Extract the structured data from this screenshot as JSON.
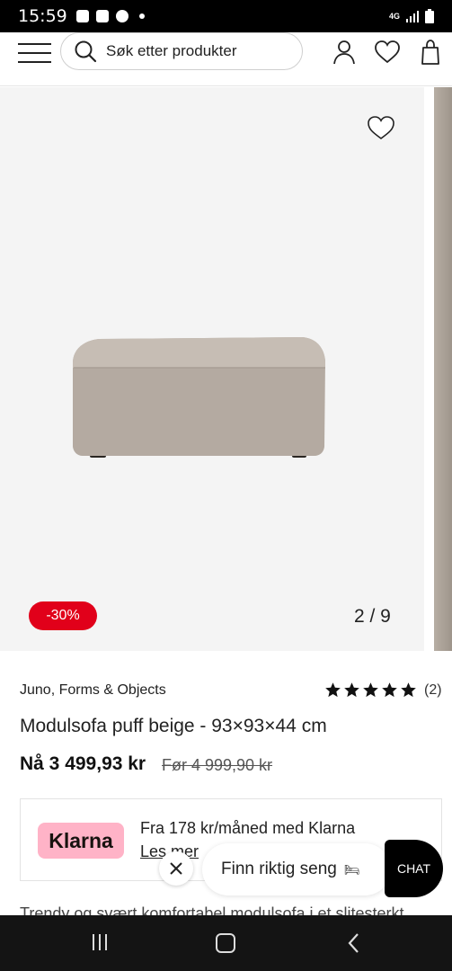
{
  "status_bar": {
    "time": "15:59",
    "network": "4G"
  },
  "header": {
    "search_placeholder": "Søk etter produkter",
    "icons": [
      "menu-icon",
      "search-icon",
      "account-icon",
      "heart-icon",
      "bag-icon"
    ]
  },
  "gallery": {
    "discount_badge": "-30%",
    "counter": "2 / 9"
  },
  "product": {
    "brand": "Juno, Forms & Objects",
    "rating_stars": 5,
    "review_count": "(2)",
    "title": "Modulsofa puff beige - 93×93×44 cm",
    "price_now": "Nå 3 499,93 kr",
    "price_before": "Før 4 999,90 kr"
  },
  "klarna": {
    "logo_text": "Klarna",
    "text": "Fra 178 kr/måned med Klarna",
    "link": "Les mer",
    "logo_color": "#ffb3c7"
  },
  "description_preview": "Trendy og svært komfortabel modulsofa i et slitesterkt",
  "help_widget": {
    "label": "Finn riktig seng",
    "chat_label": "CHAT"
  },
  "colors": {
    "accent_red": "#e1001a",
    "chat_black": "#000000"
  }
}
